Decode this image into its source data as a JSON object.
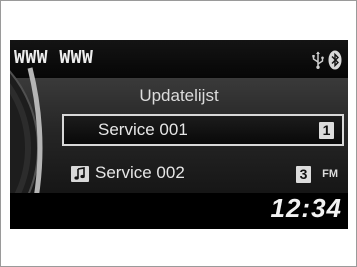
{
  "header": {
    "title": "WWW WWW",
    "icons": [
      "usb-icon",
      "bluetooth-icon"
    ]
  },
  "list": {
    "heading": "Updatelijst",
    "items": [
      {
        "label": "Service 001",
        "preset": "1",
        "selected": true
      },
      {
        "label": "Service 002",
        "preset": "3",
        "band": "FM",
        "icon": "music-note-icon",
        "selected": false
      }
    ]
  },
  "status": {
    "clock": "12:34"
  }
}
